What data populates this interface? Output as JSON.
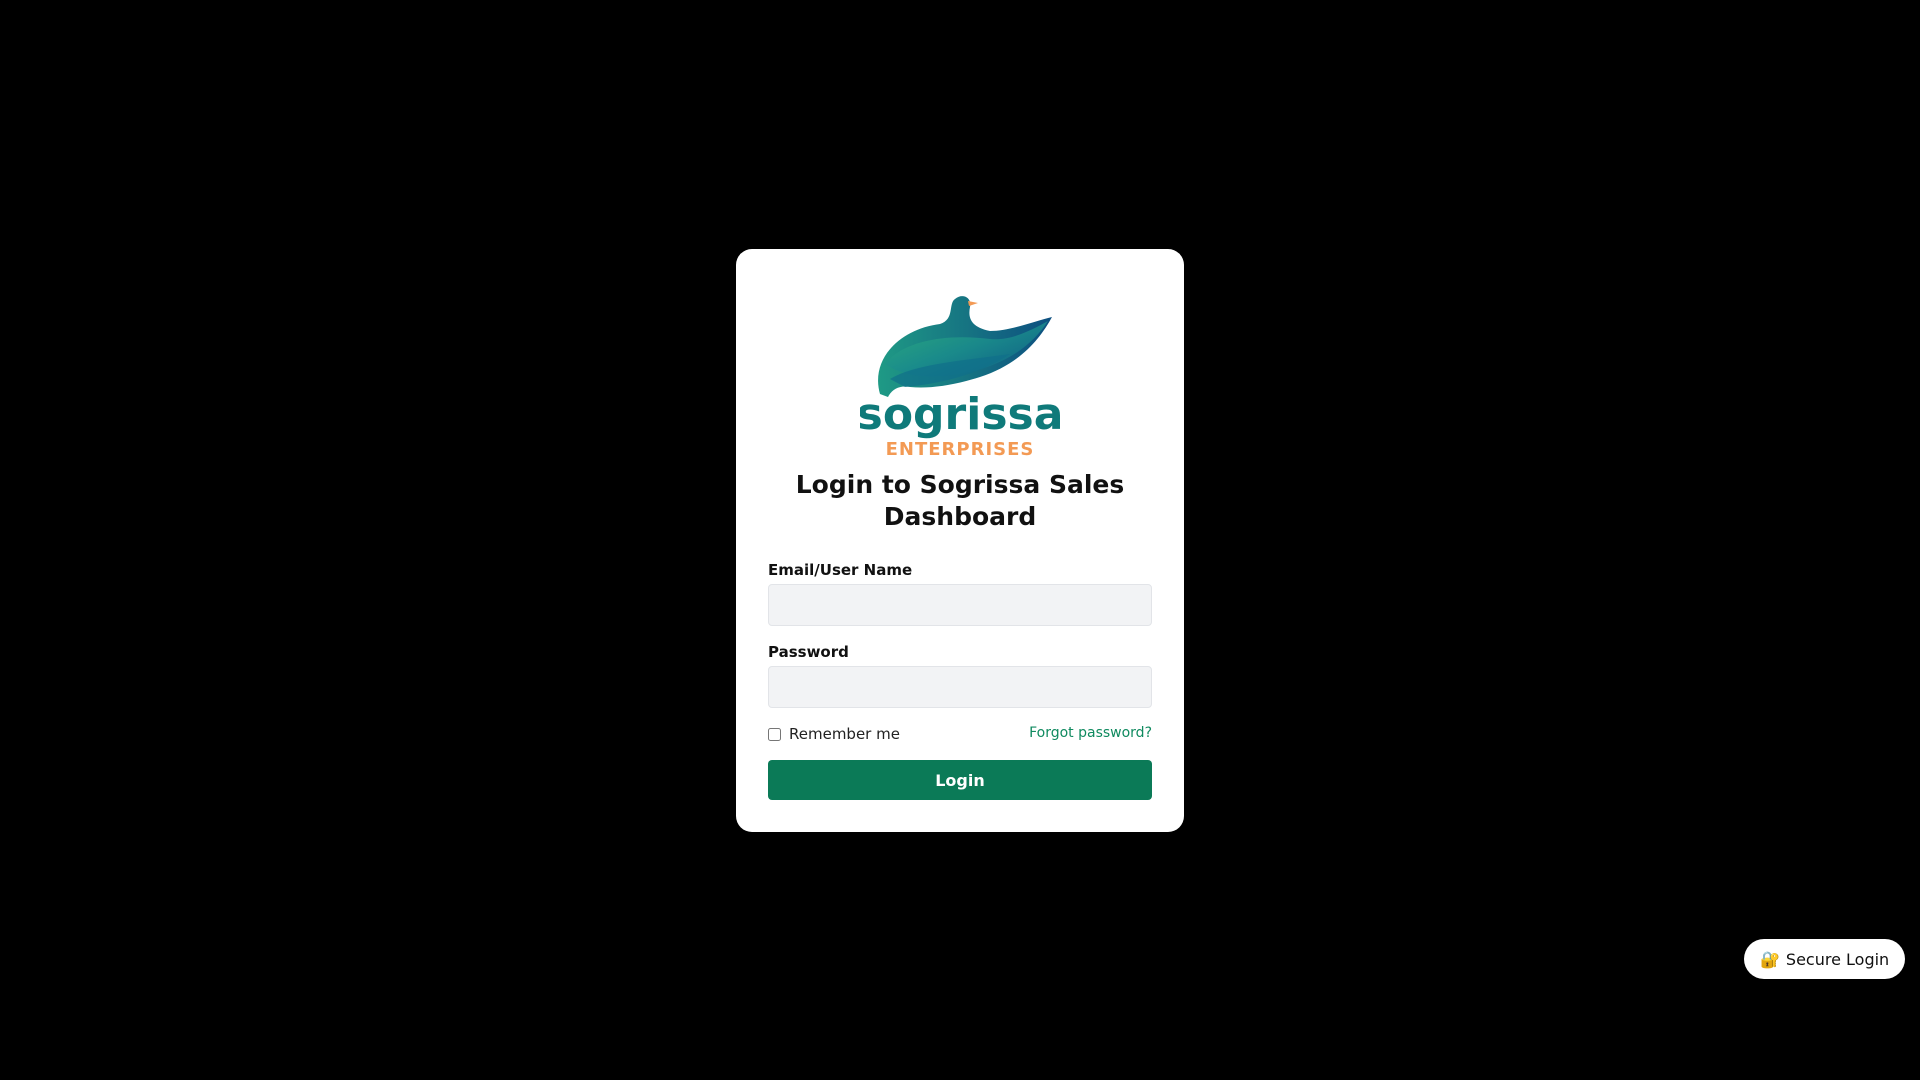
{
  "brand": {
    "name": "sogrissa",
    "subtitle": "ENTERPRISES",
    "primary_color": "#0f7a7a",
    "accent_color": "#f39a54"
  },
  "login": {
    "title": "Login to Sogrissa Sales Dashboard",
    "email_label": "Email/User Name",
    "email_value": "",
    "password_label": "Password",
    "password_value": "",
    "remember_label": "Remember me",
    "remember_checked": false,
    "forgot_label": "Forgot password?",
    "submit_label": "Login",
    "button_color": "#0b7a57",
    "link_color": "#0f8a5f"
  },
  "badge": {
    "icon": "lock-key-icon",
    "glyph": "🔐",
    "label": "Secure Login"
  }
}
